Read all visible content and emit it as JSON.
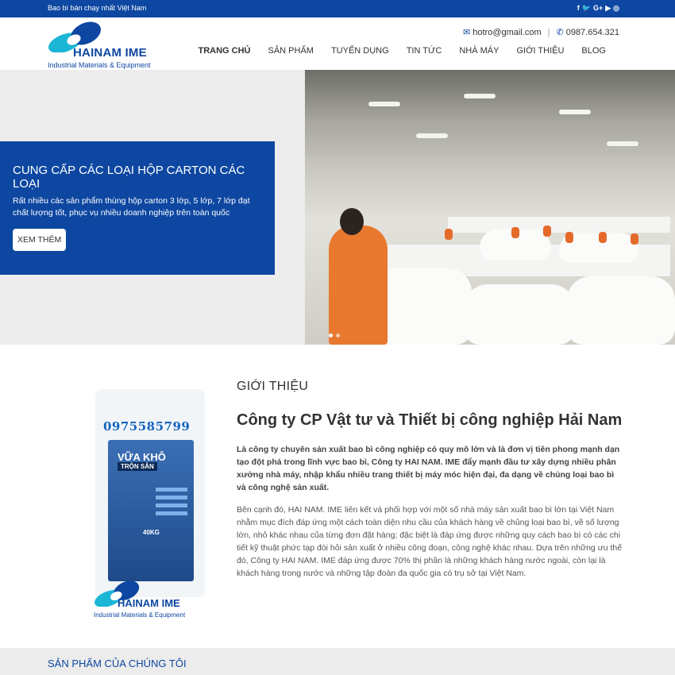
{
  "topbar": {
    "tagline": "Bao bì bán chạy nhất Việt Nam",
    "socials": [
      {
        "icon": "facebook-icon",
        "glyph": "f"
      },
      {
        "icon": "twitter-icon",
        "glyph": "🐦"
      },
      {
        "icon": "google-plus-icon",
        "glyph": "G+"
      },
      {
        "icon": "youtube-icon",
        "glyph": "▶"
      },
      {
        "icon": "instagram-icon",
        "glyph": "◎"
      }
    ]
  },
  "header": {
    "logo_brand": "HAINAM IME",
    "logo_sub": "Industrial Materials & Equipment",
    "email": "hotro@gmail.com",
    "phone": "0987.654.321",
    "nav": [
      {
        "label": "Trang chủ",
        "active": true
      },
      {
        "label": "Sản phẩm",
        "active": false
      },
      {
        "label": "Tuyển dụng",
        "active": false
      },
      {
        "label": "Tin tức",
        "active": false
      },
      {
        "label": "Nhà máy",
        "active": false
      },
      {
        "label": "Giới thiệu",
        "active": false
      },
      {
        "label": "Blog",
        "active": false
      }
    ]
  },
  "hero": {
    "title": "CUNG CẤP CÁC LOẠI HỘP CARTON CÁC LOẠI",
    "description": "Rất nhiều các sản phẩm thùng hộp carton 3 lớp, 5 lớp, 7 lớp đạt chất lượng tốt, phục vụ nhiều doanh nghiệp trên toàn quốc",
    "button": "XEM THÊM",
    "slides": 2,
    "active_slide": 0
  },
  "intro": {
    "kicker": "GIỚI THIỆU",
    "heading": "Công ty CP Vật tư và Thiết bị công nghiệp Hải Nam",
    "lead": "Là công ty chuyên sản xuất bao bì công nghiệp có quy mô lớn và là đơn vị tiên phong mạnh dạn tạo đột phá trong lĩnh vực bao bì, Công ty HAI NAM. IME đẩy mạnh đầu tư xây dựng nhiều phân xưởng nhà máy, nhập khẩu nhiều trang thiết bị máy móc hiện đại, đa dạng về chủng loại bao bì và công nghệ sản xuất.",
    "body": "Bên cạnh đó, HAI NAM. IME  liên kết và phối hợp với một số nhà máy sản xuất bao bì lớn tại Việt Nam nhằm mục đích đáp ứng một cách toàn diện nhu cầu của khách hàng về chủng loại bao bì, về số lượng lớn, nhỏ khác nhau của từng đơn đặt hàng; đặc biệt là đáp ứng được những quy cách bao bì có các chi tiết kỹ thuật phức tạp đòi hỏi sản xuất ở nhiều công đoạn, công nghệ khác nhau. Dựa trên những ưu thế đó, Công ty HAI NAM. IME đáp ứng được 70% thị phần là những khách hàng nước ngoài, còn lại là khách hàng trong nước và những tập đoàn đa quốc gia có trụ sở tại Việt Nam.",
    "image": {
      "phone": "0975585799",
      "product": "VỮA KHÔ",
      "subproduct": "TRỘN SẴN",
      "weight": "40KG",
      "logo_brand": "HAINAM IME",
      "logo_sub": "Industrial Materials & Equipment"
    }
  },
  "products": {
    "title": "SẢN PHẨM CỦA CHÚNG TÔI"
  },
  "colors": {
    "primary": "#0d47a1",
    "accent": "#1565c0",
    "light_bg": "#ececec"
  }
}
